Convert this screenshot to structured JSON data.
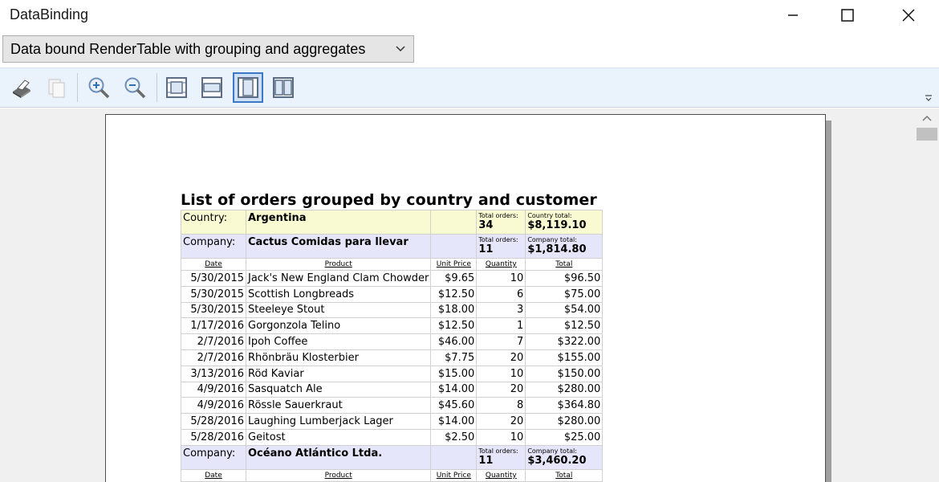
{
  "window": {
    "title": "DataBinding",
    "controls": {
      "minimize_icon": "minimize-icon",
      "maximize_icon": "maximize-icon",
      "close_icon": "close-icon"
    }
  },
  "combo": {
    "selected": "Data bound RenderTable with grouping and aggregates"
  },
  "toolbar": {
    "items": [
      {
        "name": "print-icon"
      },
      {
        "name": "copy-icon"
      },
      {
        "name": "zoom-in-icon"
      },
      {
        "name": "zoom-out-icon"
      },
      {
        "name": "actual-size-icon"
      },
      {
        "name": "page-width-icon"
      },
      {
        "name": "whole-page-icon",
        "active": true
      },
      {
        "name": "two-pages-icon"
      }
    ]
  },
  "report": {
    "title": "List of orders grouped by country and customer",
    "columns": [
      "Date",
      "Product",
      "Unit Price",
      "Quantity",
      "Total"
    ],
    "country": {
      "label": "Country:",
      "name": "Argentina",
      "total_orders_label": "Total orders:",
      "total_orders": "34",
      "total_label": "Country total:",
      "total": "$8,119.10"
    },
    "companies": [
      {
        "label": "Company:",
        "name": "Cactus Comidas para llevar",
        "total_orders_label": "Total orders:",
        "total_orders": "11",
        "total_label": "Company total:",
        "total": "$1,814.80",
        "rows": [
          [
            "5/30/2015",
            "Jack's New England Clam Chowder",
            "$9.65",
            "10",
            "$96.50"
          ],
          [
            "5/30/2015",
            "Scottish Longbreads",
            "$12.50",
            "6",
            "$75.00"
          ],
          [
            "5/30/2015",
            "Steeleye Stout",
            "$18.00",
            "3",
            "$54.00"
          ],
          [
            "1/17/2016",
            "Gorgonzola Telino",
            "$12.50",
            "1",
            "$12.50"
          ],
          [
            "2/7/2016",
            "Ipoh Coffee",
            "$46.00",
            "7",
            "$322.00"
          ],
          [
            "2/7/2016",
            "Rhönbräu Klosterbier",
            "$7.75",
            "20",
            "$155.00"
          ],
          [
            "3/13/2016",
            "Röd Kaviar",
            "$15.00",
            "10",
            "$150.00"
          ],
          [
            "4/9/2016",
            "Sasquatch Ale",
            "$14.00",
            "20",
            "$280.00"
          ],
          [
            "4/9/2016",
            "Rössle Sauerkraut",
            "$45.60",
            "8",
            "$364.80"
          ],
          [
            "5/28/2016",
            "Laughing Lumberjack Lager",
            "$14.00",
            "20",
            "$280.00"
          ],
          [
            "5/28/2016",
            "Geitost",
            "$2.50",
            "10",
            "$25.00"
          ]
        ]
      },
      {
        "label": "Company:",
        "name": "Océano Atlántico Ltda.",
        "total_orders_label": "Total orders:",
        "total_orders": "11",
        "total_label": "Company total:",
        "total": "$3,460.20",
        "rows": []
      }
    ]
  }
}
